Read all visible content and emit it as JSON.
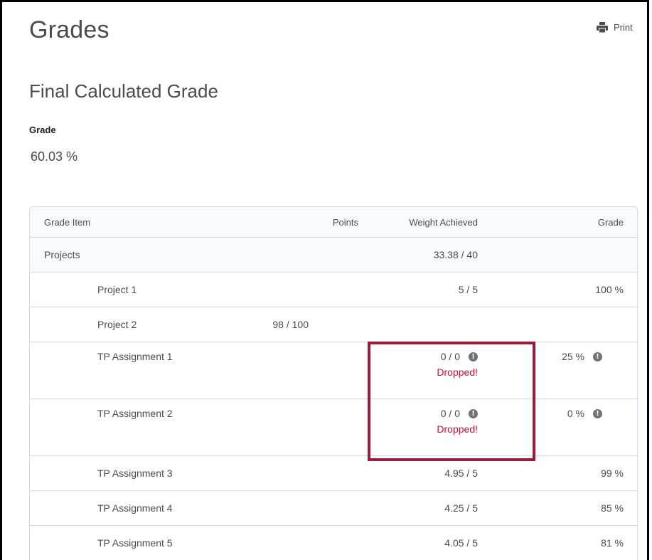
{
  "header": {
    "title": "Grades",
    "print_label": "Print",
    "print_icon": "printer-icon"
  },
  "final_grade": {
    "section_title": "Final Calculated Grade",
    "grade_label": "Grade",
    "grade_value": "60.03 %"
  },
  "table": {
    "columns": {
      "item": "Grade Item",
      "points": "Points",
      "weight": "Weight Achieved",
      "grade": "Grade"
    },
    "category": {
      "name": "Projects",
      "points": "",
      "weight": "33.38 / 40",
      "grade": ""
    },
    "rows": [
      {
        "name": "Project 1",
        "points": "",
        "weight": "5 / 5",
        "grade": "100 %"
      },
      {
        "name": "Project 2",
        "points": "98 / 100",
        "weight": "",
        "grade": ""
      },
      {
        "name": "TP Assignment 1",
        "points": "",
        "weight": "0 / 0",
        "weight_note": "Dropped!",
        "grade": "25 %"
      },
      {
        "name": "TP Assignment 2",
        "points": "",
        "weight": "0 / 0",
        "weight_note": "Dropped!",
        "grade": "0 %"
      },
      {
        "name": "TP Assignment 3",
        "points": "",
        "weight": "4.95 / 5",
        "grade": "99 %"
      },
      {
        "name": "TP Assignment 4",
        "points": "",
        "weight": "4.25 / 5",
        "grade": "85 %"
      },
      {
        "name": "TP Assignment 5",
        "points": "",
        "weight": "4.05 / 5",
        "grade": "81 %"
      }
    ]
  },
  "colors": {
    "dropped": "#c00f3a",
    "highlight": "#a0193a",
    "border": "#d3d9e3"
  }
}
